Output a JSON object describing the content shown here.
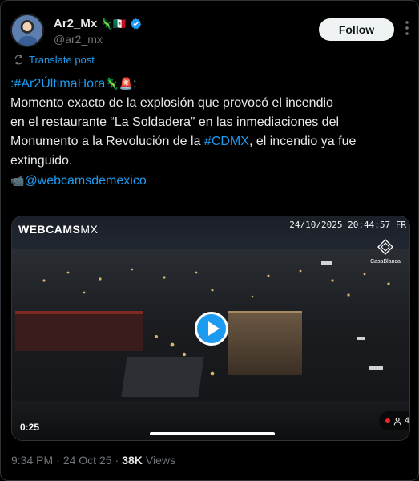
{
  "author": {
    "display_name": "Ar2_Mx",
    "flags": "🦎🇲🇽",
    "handle": "@ar2_mx",
    "verified_icon": "verified-badge-icon"
  },
  "actions": {
    "follow_label": "Follow",
    "more_icon": "more-dots-icon"
  },
  "translate": {
    "label": "Translate post",
    "icon": "translate-icon"
  },
  "tweet": {
    "hashtag_main": ":#Ar2ÚltimaHora",
    "hashtag_emojis": "🦎🚨",
    "hashtag_tail": ":",
    "line1": "Momento exacto de la explosión que provocó el incendio",
    "line2": "en el restaurante “La Soldadera” en las inmediaciones del",
    "line3_pre": "Monumento a la Revolución de la ",
    "line3_tag": "#CDMX",
    "line3_post": ", el incendio ya fue",
    "line4": "extinguido.",
    "camera_emoji": "📹",
    "mention": "@webcamsdemexico"
  },
  "media": {
    "watermark_brand": "WEBCAMS",
    "watermark_suffix": "MX",
    "overlay_timestamp": "24/10/2025 20:44:57 FR",
    "partner_label": "CasaBlanca",
    "duration": "0:25",
    "viewer_count": "4",
    "play_icon": "play-icon",
    "live_color": "#f4212e",
    "accent_color": "#1d9bf0"
  },
  "meta": {
    "time": "9:34 PM",
    "sep1": "·",
    "date": "24 Oct 25",
    "sep2": "·",
    "views_count": "38K",
    "views_label": "Views"
  }
}
